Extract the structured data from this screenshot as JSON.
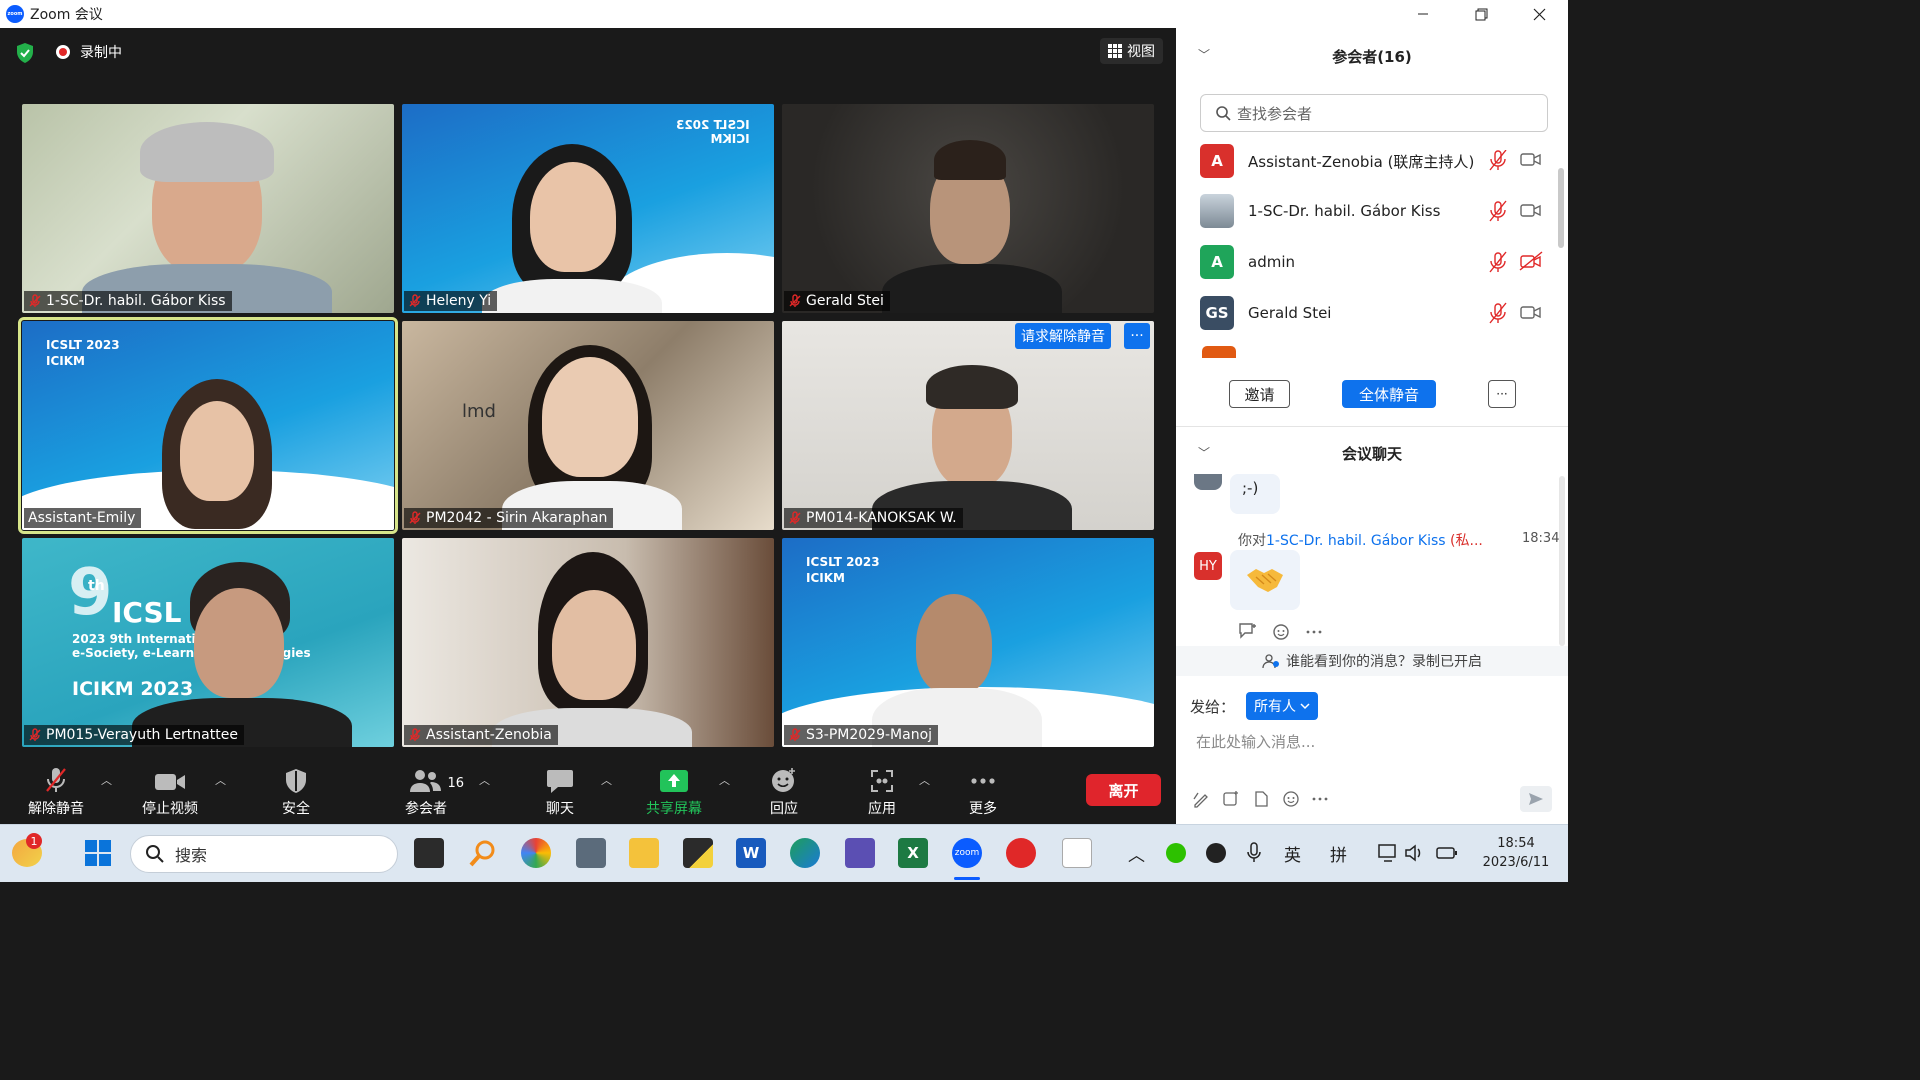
{
  "window": {
    "title": "Zoom 会议"
  },
  "meeting": {
    "recording_label": "录制中",
    "view_label": "视图",
    "unmute_request_label": "请求解除静音",
    "tiles": [
      {
        "name": "1-SC-Dr. habil. Gábor Kiss"
      },
      {
        "name": "Heleny Yi"
      },
      {
        "name": "Gerald Stei"
      },
      {
        "name": "Assistant-Emily"
      },
      {
        "name": "PM2042 - Sirin Akaraphan"
      },
      {
        "name": "PM014-KANOKSAK W."
      },
      {
        "name": "PM015-Verayuth Lertnattee"
      },
      {
        "name": "Assistant-Zenobia"
      },
      {
        "name": "S3-PM2029-Manoj"
      }
    ],
    "banner": {
      "line1": "ICSLT 2023",
      "line2": "ICIKM"
    },
    "banner_big": {
      "num": "9",
      "sup": "th",
      "line1": "ICSL",
      "line2": "2023 9th Internati",
      "line3": "e-Society, e-Learni",
      "line4": "ICIKM 2023",
      "tail1": "on",
      "tail2": "ologies"
    },
    "photo_text": "lmd"
  },
  "toolbar": {
    "unmute": "解除静音",
    "stop_video": "停止视频",
    "security": "安全",
    "participants": "参会者",
    "participants_count": "16",
    "chat": "聊天",
    "share": "共享屏幕",
    "reactions": "回应",
    "apps": "应用",
    "more": "更多",
    "leave": "离开"
  },
  "participants_panel": {
    "title": "参会者(16)",
    "search_placeholder": "查找参会者",
    "list": [
      {
        "avatar": "A",
        "name": "Assistant-Zenobia (联席主持人)",
        "color": "#d9302c"
      },
      {
        "avatar": "",
        "name": "1-SC-Dr. habil. Gábor Kiss",
        "color": "#9aa7b3"
      },
      {
        "avatar": "A",
        "name": "admin",
        "color": "#1fa55a"
      },
      {
        "avatar": "GS",
        "name": "Gerald Stei",
        "color": "#3a4d63"
      }
    ],
    "invite": "邀请",
    "mute_all": "全体静音",
    "more": "···"
  },
  "chat_panel": {
    "title": "会议聊天",
    "msg1": ";-)",
    "msg2_prefix": "你对",
    "msg2_target": "1-SC-Dr. habil. Gábor Kiss",
    "msg2_private": "(私...",
    "msg2_time": "18:34",
    "sender_avatar": "HY",
    "visibility_note": "谁能看到你的消息？录制已开启",
    "send_to_label": "发给：",
    "send_to_value": "所有人",
    "input_placeholder": "在此处输入消息..."
  },
  "taskbar": {
    "search": "搜索",
    "badge": "1",
    "zoom_label": "zoom",
    "ime1": "英",
    "ime2": "拼",
    "time": "18:54",
    "date": "2023/6/11"
  }
}
